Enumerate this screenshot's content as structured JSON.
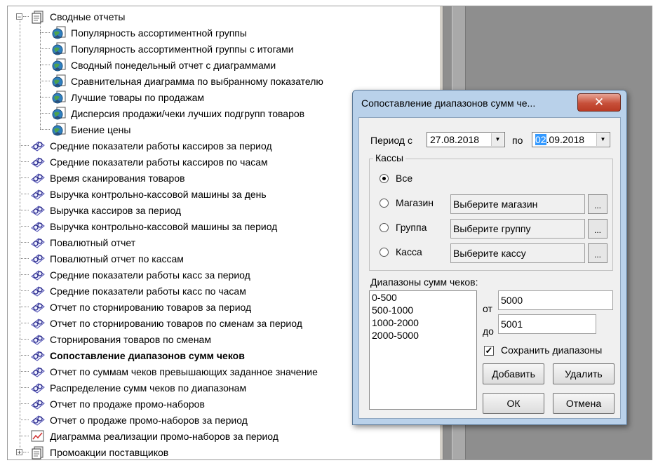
{
  "tree": {
    "items": [
      {
        "label": "Сводные отчеты",
        "icon": "report-folder-icon",
        "level": 0,
        "expander": "−",
        "bold": false
      },
      {
        "label": "Популярность  ассортиментной группы",
        "icon": "report-globe-icon",
        "level": 1,
        "bold": false
      },
      {
        "label": "Популярность ассортиментной группы с итогами",
        "icon": "report-globe-icon",
        "level": 1,
        "bold": false
      },
      {
        "label": "Сводный понедельный отчет с диаграммами",
        "icon": "report-globe-icon",
        "level": 1,
        "bold": false
      },
      {
        "label": "Сравнительная диаграмма по выбранному показателю",
        "icon": "report-globe-icon",
        "level": 1,
        "bold": false
      },
      {
        "label": "Лучшие товары по продажам",
        "icon": "report-globe-icon",
        "level": 1,
        "bold": false
      },
      {
        "label": "Дисперсия продажи/чеки лучших подгрупп товаров",
        "icon": "report-globe-icon",
        "level": 1,
        "bold": false
      },
      {
        "label": "Биение цены",
        "icon": "report-globe-icon",
        "level": 1,
        "bold": false
      },
      {
        "label": "Средние показатели работы кассиров за период",
        "icon": "report-glasses-icon",
        "level": 0,
        "bold": false
      },
      {
        "label": "Средние показатели работы кассиров по часам",
        "icon": "report-glasses-icon",
        "level": 0,
        "bold": false
      },
      {
        "label": "Время сканирования товаров",
        "icon": "report-glasses-icon",
        "level": 0,
        "bold": false
      },
      {
        "label": "Выручка контрольно-кассовой машины за день",
        "icon": "report-glasses-icon",
        "level": 0,
        "bold": false
      },
      {
        "label": "Выручка кассиров за период",
        "icon": "report-glasses-icon",
        "level": 0,
        "bold": false
      },
      {
        "label": "Выручка контрольно-кассовой машины за период",
        "icon": "report-glasses-icon",
        "level": 0,
        "bold": false
      },
      {
        "label": "Повалютный отчет",
        "icon": "report-glasses-icon",
        "level": 0,
        "bold": false
      },
      {
        "label": "Повалютный отчет по кассам",
        "icon": "report-glasses-icon",
        "level": 0,
        "bold": false
      },
      {
        "label": "Средние показатели работы касс за период",
        "icon": "report-glasses-icon",
        "level": 0,
        "bold": false
      },
      {
        "label": "Средние показатели работы касс по часам",
        "icon": "report-glasses-icon",
        "level": 0,
        "bold": false
      },
      {
        "label": "Отчет по сторнированию товаров за период",
        "icon": "report-glasses-icon",
        "level": 0,
        "bold": false
      },
      {
        "label": "Отчет по сторнированию товаров по сменам за период",
        "icon": "report-glasses-icon",
        "level": 0,
        "bold": false
      },
      {
        "label": "Сторнирования товаров по сменам",
        "icon": "report-glasses-icon",
        "level": 0,
        "bold": false
      },
      {
        "label": "Сопоставление диапазонов сумм чеков",
        "icon": "report-glasses-icon",
        "level": 0,
        "bold": true
      },
      {
        "label": "Отчет по суммам чеков превышающих заданное значение",
        "icon": "report-glasses-icon",
        "level": 0,
        "bold": false
      },
      {
        "label": "Распределение  сумм чеков по диапазонам",
        "icon": "report-glasses-icon",
        "level": 0,
        "bold": false
      },
      {
        "label": "Отчет по продаже промо-наборов",
        "icon": "report-glasses-icon",
        "level": 0,
        "bold": false
      },
      {
        "label": "Отчет о продаже промо-наборов за период",
        "icon": "report-glasses-icon",
        "level": 0,
        "bold": false
      },
      {
        "label": "Диаграмма реализации промо-наборов за период",
        "icon": "report-chart-icon",
        "level": 0,
        "bold": false
      },
      {
        "label": "Промоакции поставщиков",
        "icon": "report-folder-icon",
        "level": 0,
        "expander": "+",
        "bold": false
      }
    ]
  },
  "dialog": {
    "title": "Сопоставление диапазонов сумм че...",
    "close_label": "✕",
    "period_label": "Период с",
    "date_from": "27.08.2018",
    "to_label": "по",
    "date_to_selected": "02",
    "date_to_rest": ".09.2018",
    "cash_group_label": "Кассы",
    "radio_all": "Все",
    "radio_store": "Магазин",
    "radio_group": "Группа",
    "radio_register": "Касса",
    "store_placeholder": "Выберите магазин",
    "group_placeholder": "Выберите группу",
    "register_placeholder": "Выберите кассу",
    "browse_label": "...",
    "ranges_label": "Диапазоны сумм чеков:",
    "ranges": [
      "0-500",
      "500-1000",
      "1000-2000",
      "2000-5000"
    ],
    "from_label": "от",
    "from_value": "5000",
    "to_value_label": "до",
    "to_value": "5001",
    "save_ranges_label": "Сохранить диапазоны",
    "save_ranges_checked": true,
    "add_label": "Добавить",
    "delete_label": "Удалить",
    "ok_label": "ОК",
    "cancel_label": "Отмена"
  }
}
